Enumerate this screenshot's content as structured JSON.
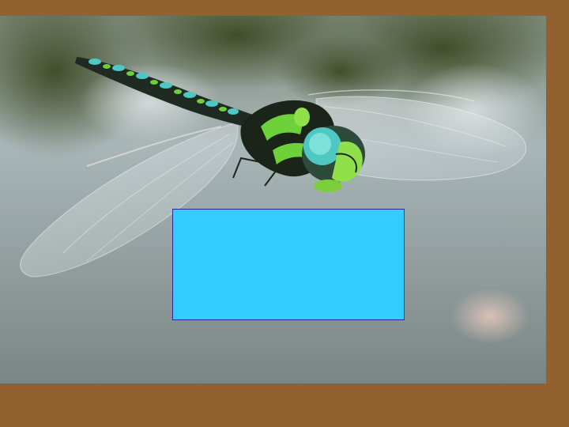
{
  "colors": {
    "frame": "#93612f",
    "water_light": "#a9b6b8",
    "water_dark": "#6f7f7d",
    "foliage": "#4f5a2e",
    "overlay_fill": "#33ccff",
    "overlay_border": "#2a2aa0",
    "dragonfly_body": "#1f2a22",
    "dragonfly_markings": "#6fd13a",
    "dragonfly_blue": "#4fc7c2"
  },
  "image": {
    "subject": "dragonfly-photo"
  }
}
